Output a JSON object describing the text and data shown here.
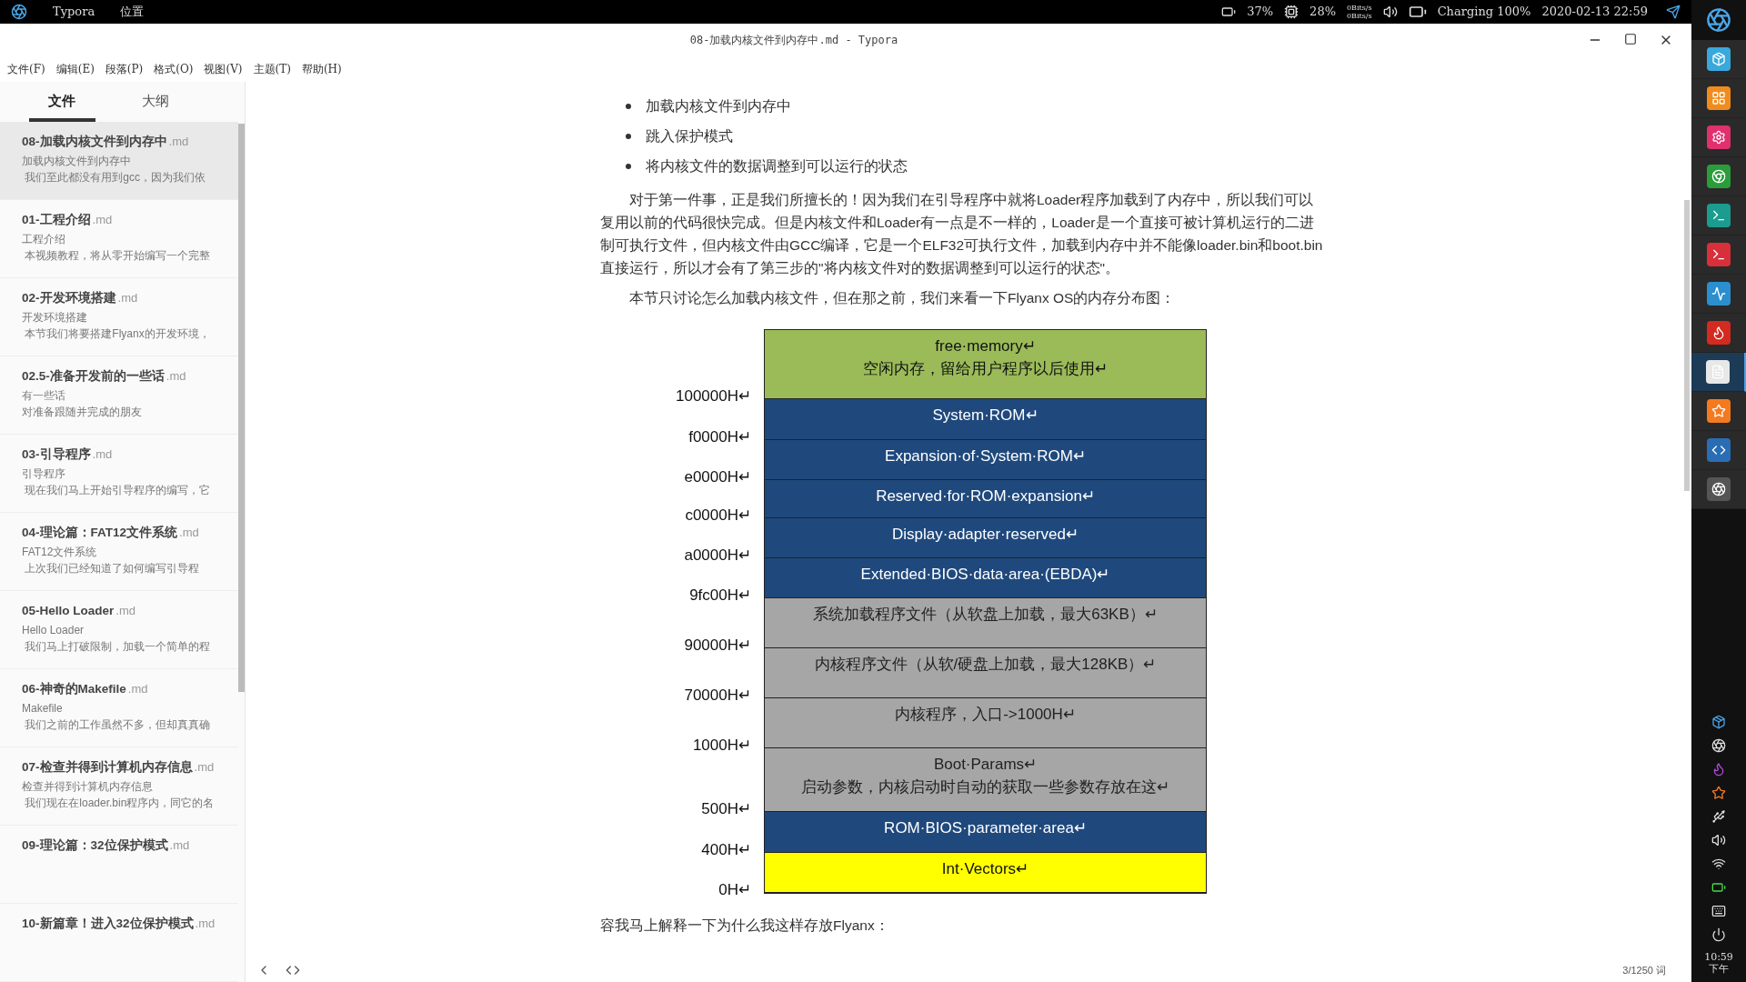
{
  "top_bar": {
    "app": "Typora",
    "menu": "位置",
    "battery_pct": "37%",
    "cpu_pct": "28%",
    "net_up": "0Bits/s",
    "net_down": "0Bits/s",
    "charging": "Charging 100%",
    "datetime": "2020-02-13 22:59"
  },
  "window": {
    "title": "08-加载内核文件到内存中.md - Typora"
  },
  "menu": [
    "文件(F)",
    "编辑(E)",
    "段落(P)",
    "格式(O)",
    "视图(V)",
    "主题(T)",
    "帮助(H)"
  ],
  "sidebar": {
    "tabs": [
      {
        "label": "文件",
        "selected": true
      },
      {
        "label": "大纲",
        "selected": false
      }
    ],
    "files": [
      {
        "title": "08-加载内核文件到内存中",
        "ext": ".md",
        "subtitle": "加载内核文件到内存中",
        "excerpt": " 我们至此都没有用到gcc，因为我们依",
        "selected": true
      },
      {
        "title": "01-工程介绍",
        "ext": ".md",
        "subtitle": "工程介绍",
        "excerpt": " 本视频教程，将从零开始编写一个完整",
        "selected": false
      },
      {
        "title": "02-开发环境搭建",
        "ext": ".md",
        "subtitle": "开发环境搭建",
        "excerpt": " 本节我们将要搭建Flyanx的开发环境，",
        "selected": false
      },
      {
        "title": "02.5-准备开发前的一些话",
        "ext": ".md",
        "subtitle": "有一些话",
        "excerpt": "对准备跟随并完成的朋友",
        "selected": false
      },
      {
        "title": "03-引导程序",
        "ext": ".md",
        "subtitle": "引导程序",
        "excerpt": " 现在我们马上开始引导程序的编写，它",
        "selected": false
      },
      {
        "title": "04-理论篇：FAT12文件系统",
        "ext": ".md",
        "subtitle": "FAT12文件系统",
        "excerpt": " 上次我们已经知道了如何编写引导程",
        "selected": false
      },
      {
        "title": "05-Hello Loader",
        "ext": ".md",
        "subtitle": "Hello Loader",
        "excerpt": " 我们马上打破限制，加载一个简单的程",
        "selected": false
      },
      {
        "title": "06-神奇的Makefile",
        "ext": ".md",
        "subtitle": "Makefile",
        "excerpt": " 我们之前的工作虽然不多，但却真真确",
        "selected": false
      },
      {
        "title": "07-检查并得到计算机内存信息",
        "ext": ".md",
        "subtitle": "检查并得到计算机内存信息",
        "excerpt": " 我们现在在loader.bin程序内，同它的名",
        "selected": false
      },
      {
        "title": "09-理论篇：32位保护模式",
        "ext": ".md",
        "selected": false
      },
      {
        "title": "10-新篇章！进入32位保护模式",
        "ext": ".md",
        "selected": false
      }
    ]
  },
  "document": {
    "bullets": [
      "加载内核文件到内存中",
      "跳入保护模式",
      "将内核文件的数据调整到可以运行的状态"
    ],
    "paragraphs": [
      "对于第一件事，正是我们所擅长的！因为我们在引导程序中就将Loader程序加载到了内存中，所以我们可以复用以前的代码很快完成。但是内核文件和Loader有一点是不一样的，Loader是一个直接可被计算机运行的二进制可执行文件，但内核文件由GCC编译，它是一个ELF32可执行文件，加载到内存中并不能像loader.bin和boot.bin直接运行，所以才会有了第三步的\"将内核文件对的数据调整到可以运行的状态\"。",
      "本节只讨论怎么加载内核文件，但在那之前，我们来看一下Flyanx OS的内存分布图："
    ],
    "memory_map": [
      {
        "kind": "free",
        "lines": [
          "free·memory↵",
          "空闲内存，留给用户程序以后使用↵"
        ],
        "address": "100000H↵"
      },
      {
        "kind": "rom",
        "lines": [
          "System·ROM↵"
        ],
        "address": "f0000H↵"
      },
      {
        "kind": "rom",
        "lines": [
          "Expansion·of·System·ROM↵"
        ],
        "address": "e0000H↵"
      },
      {
        "kind": "rom",
        "lines": [
          "Reserved·for·ROM·expansion↵"
        ],
        "address": "c0000H↵"
      },
      {
        "kind": "rom",
        "lines": [
          "Display·adapter·reserved↵"
        ],
        "address": "a0000H↵"
      },
      {
        "kind": "rom",
        "lines": [
          "Extended·BIOS·data·area·(EBDA)↵"
        ],
        "address": "9fc00H↵"
      },
      {
        "kind": "program",
        "lines": [
          "系统加载程序文件（从软盘上加载，最大63KB）↵"
        ],
        "address": "90000H↵"
      },
      {
        "kind": "program",
        "lines": [
          "内核程序文件（从软/硬盘上加载，最大128KB）↵"
        ],
        "address": "70000H↵"
      },
      {
        "kind": "program",
        "lines": [
          "内核程序，入口->1000H↵"
        ],
        "address": "1000H↵"
      },
      {
        "kind": "program",
        "lines": [
          "Boot·Params↵",
          "启动参数，内核启动时自动的获取一些参数存放在这↵"
        ],
        "address": "500H↵"
      },
      {
        "kind": "rom",
        "lines": [
          "ROM·BIOS·parameter·area↵"
        ],
        "address": "400H↵"
      },
      {
        "kind": "vector",
        "lines": [
          "Int·Vectors↵"
        ],
        "address": "0H↵"
      }
    ],
    "after": "容我马上解释一下为什么我这样存放Flyanx："
  },
  "status_bar": {
    "word_count": "3/1250 词"
  },
  "dock": {
    "items": [
      {
        "selected": false
      },
      {
        "selected": false
      },
      {
        "selected": false
      },
      {
        "selected": false
      },
      {
        "selected": false
      },
      {
        "selected": false
      },
      {
        "selected": false
      },
      {
        "selected": false
      },
      {
        "selected": true
      },
      {
        "selected": false
      },
      {
        "selected": false
      },
      {
        "selected": false
      }
    ]
  },
  "tray": {
    "time": "10:59",
    "period": "下午"
  }
}
